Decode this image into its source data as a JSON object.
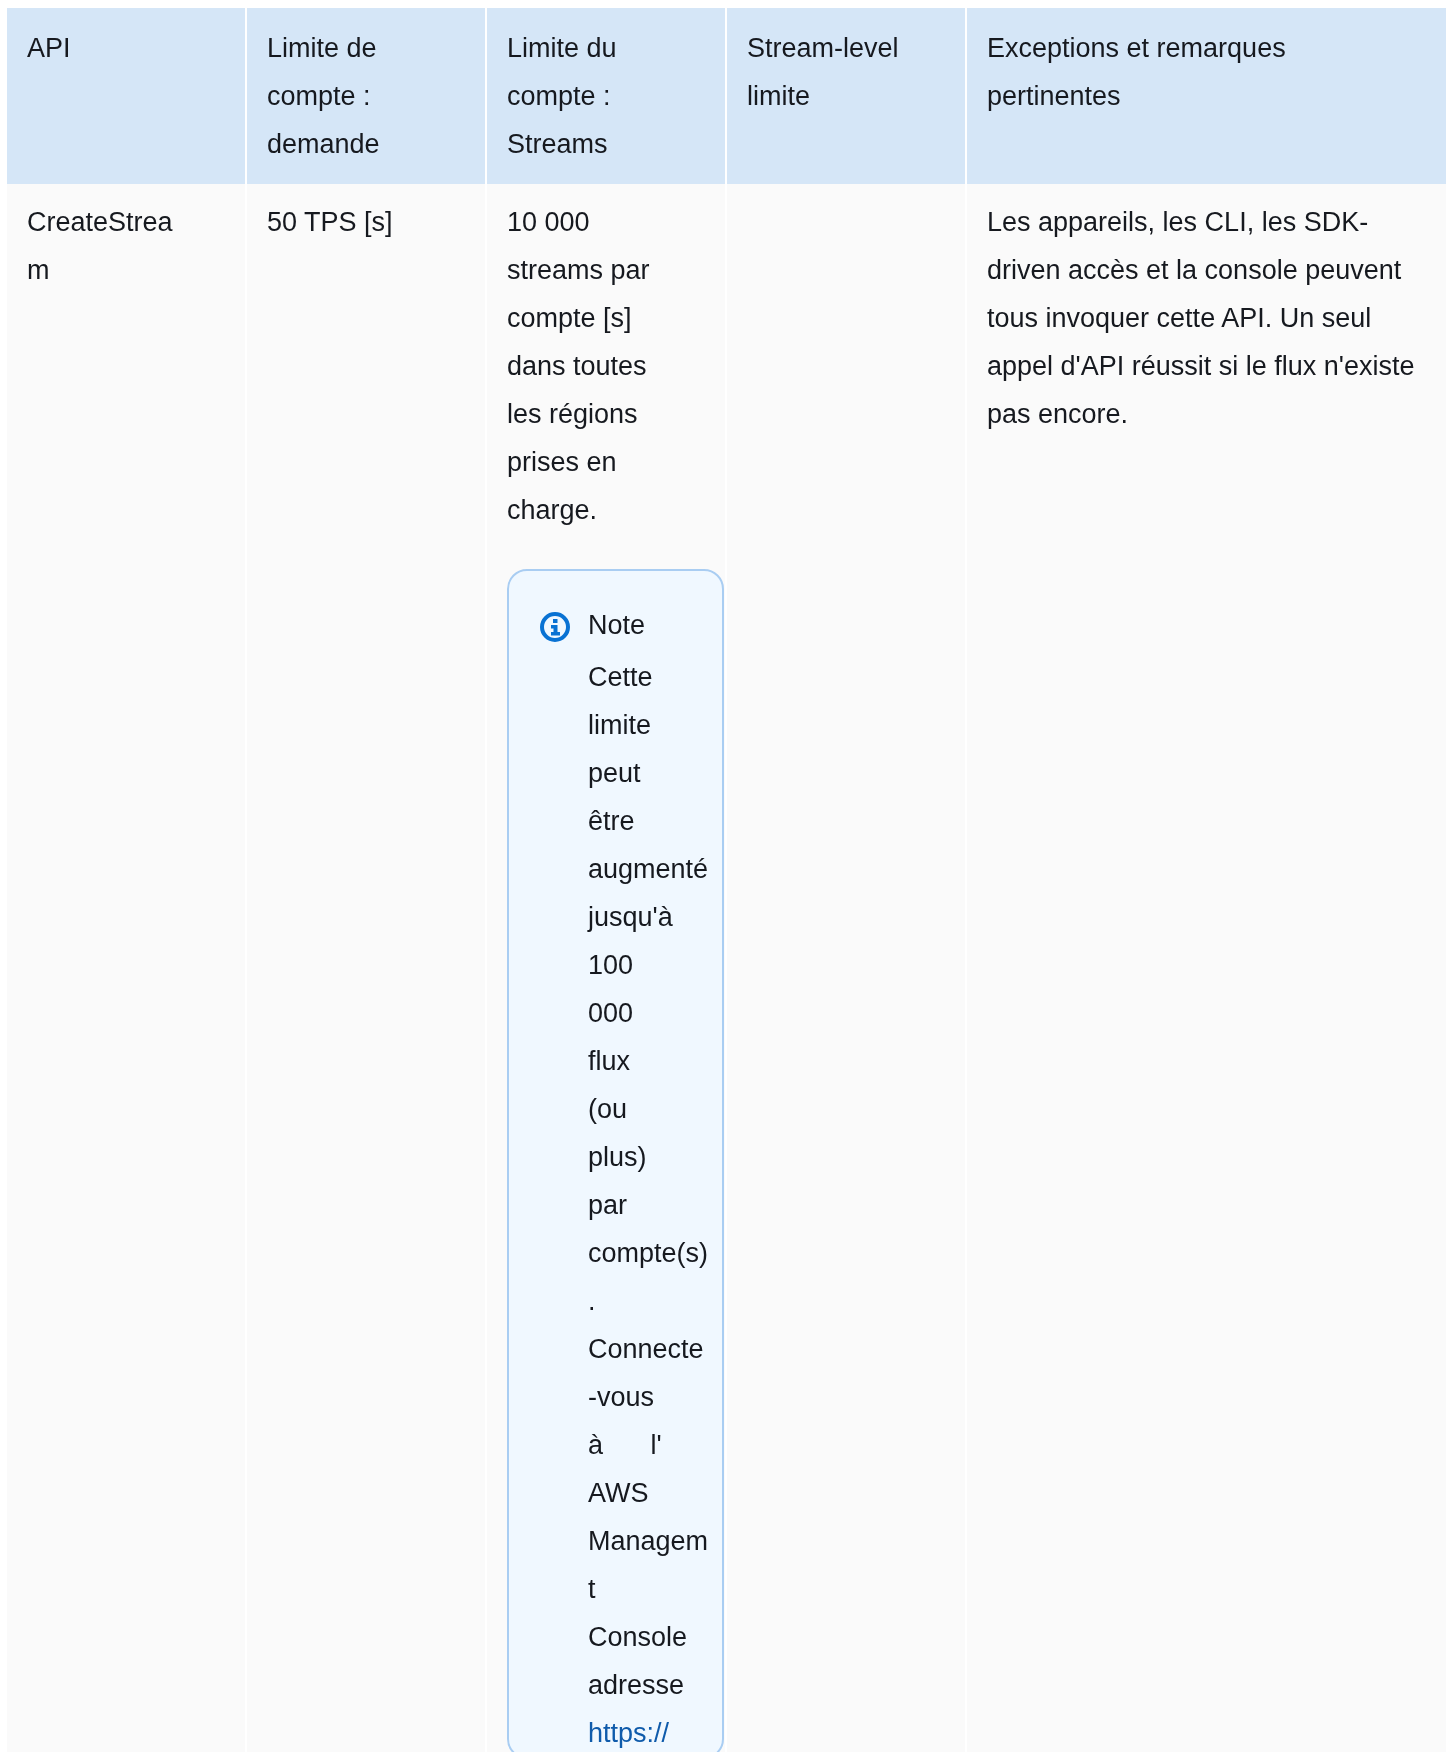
{
  "table": {
    "columns": [
      "API",
      "Limite de compte : demande",
      "Limite du compte : Streams",
      "Stream-level limite",
      "Exceptions et remarques pertinentes"
    ],
    "rows": [
      {
        "cells": [
          {
            "text": "CreateStream"
          },
          {
            "text": "50 TPS [s]"
          },
          {
            "text": "10 000 streams par compte [s] dans toutes les régions prises en charge.",
            "note": {
              "title": "Note",
              "text": "Cette limite peut être augmenté jusqu'à 100 000 flux (ou plus) par compte(s) . Connecte -vous à l' AWS Managem t Console adresse",
              "link": "https://"
            }
          },
          {
            "text": ""
          },
          {
            "text": "Les appareils, les CLI, les SDK-driven accès et la console peuvent tous invoquer cette API. Un seul appel d'API réussit si le flux n'existe pas encore."
          }
        ]
      }
    ]
  }
}
